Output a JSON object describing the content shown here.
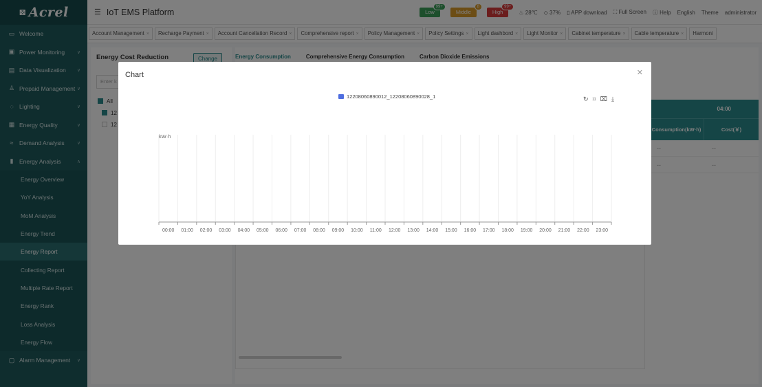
{
  "sidebar": {
    "logo_text": "Acrel",
    "items": [
      {
        "label": "Welcome",
        "icon": "monitor-icon",
        "chevron": false
      },
      {
        "label": "Power Monitoring",
        "icon": "power-icon",
        "chevron": true
      },
      {
        "label": "Data Visualization",
        "icon": "screen-icon",
        "chevron": true
      },
      {
        "label": "Prepaid Management",
        "icon": "users-icon",
        "chevron": true
      },
      {
        "label": "Lighting",
        "icon": "bulb-icon",
        "chevron": true
      },
      {
        "label": "Energy Quality",
        "icon": "quality-icon",
        "chevron": true
      },
      {
        "label": "Demand Analysis",
        "icon": "demand-icon",
        "chevron": true
      },
      {
        "label": "Energy Analysis",
        "icon": "bar-chart-icon",
        "chevron": true,
        "expanded": true
      }
    ],
    "sub_items": [
      {
        "label": "Energy Overview",
        "active": false
      },
      {
        "label": "YoY Analysis",
        "active": false
      },
      {
        "label": "MoM Analysis",
        "active": false
      },
      {
        "label": "Energy Trend",
        "active": false
      },
      {
        "label": "Energy Report",
        "active": true
      },
      {
        "label": "Collecting Report",
        "active": false
      },
      {
        "label": "Multiple Rate Report",
        "active": false
      },
      {
        "label": "Energy Rank",
        "active": false
      },
      {
        "label": "Loss Analysis",
        "active": false
      },
      {
        "label": "Energy Flow",
        "active": false
      }
    ],
    "bottom_item": {
      "label": "Alarm Management",
      "icon": "alarm-icon"
    }
  },
  "header": {
    "title": "IoT EMS Platform",
    "alarms": {
      "low": {
        "label": "Low",
        "count": "99+"
      },
      "middle": {
        "label": "Middle",
        "count": "8"
      },
      "high": {
        "label": "High",
        "count": "99+"
      }
    },
    "temperature": "28℃",
    "humidity": "37%",
    "app_download": "APP download",
    "full_screen": "Full Screen",
    "help": "Help",
    "language": "English",
    "theme": "Theme",
    "user": "administrator"
  },
  "tabs": [
    "Account Management",
    "Recharge Payment",
    "Account Cancellation Record",
    "Comprehensive report",
    "Policy Management",
    "Policy Settings",
    "Light dashbord",
    "Light Monitor",
    "Cabinet temperature",
    "Cable temperature",
    "Harmoni"
  ],
  "left_panel": {
    "title": "Energy Cost Reduction",
    "change_button": "Change",
    "search_placeholder": "Enter k",
    "tree_all": "All",
    "tree_node_1": "12",
    "tree_node_2": "12"
  },
  "right_panel": {
    "tabs": [
      "Energy Consumption",
      "Comprehensive Energy Consumption",
      "Carbon Dioxide Emissions"
    ],
    "active_tab": 0,
    "table_time_header": "04:00",
    "col_consumption": "Consumption(kW·h)",
    "col_cost": "Cost(￥)",
    "rows": [
      [
        "--",
        "--"
      ],
      [
        "--",
        "--"
      ]
    ]
  },
  "modal": {
    "title": "Chart",
    "close_icon": "close-icon",
    "toolbox_icons": [
      "restore-icon",
      "zoom-icon",
      "zoom-reset-icon",
      "download-icon"
    ]
  },
  "chart_data": {
    "type": "bar",
    "series": [
      {
        "name": "12208060890012_12208060890028_1",
        "values": [
          null,
          null,
          null,
          null,
          null,
          null,
          null,
          null,
          null,
          null,
          null,
          null,
          null,
          null,
          null,
          null,
          null,
          null,
          null,
          null,
          null,
          null,
          null,
          null
        ],
        "color": "#4f6ee0"
      }
    ],
    "categories": [
      "00:00",
      "01:00",
      "02:00",
      "03:00",
      "04:00",
      "05:00",
      "06:00",
      "07:00",
      "08:00",
      "09:00",
      "10:00",
      "11:00",
      "12:00",
      "13:00",
      "14:00",
      "15:00",
      "16:00",
      "17:00",
      "18:00",
      "19:00",
      "20:00",
      "21:00",
      "22:00",
      "23:00"
    ],
    "ylabel": "kW·h",
    "legend_position": "top-center",
    "grid": true
  },
  "colors": {
    "sidebar_bg": "#1e5a5c",
    "accent": "#2b8a8c",
    "low": "#3a9e58",
    "middle": "#d89a2b",
    "high": "#d63b3b"
  }
}
